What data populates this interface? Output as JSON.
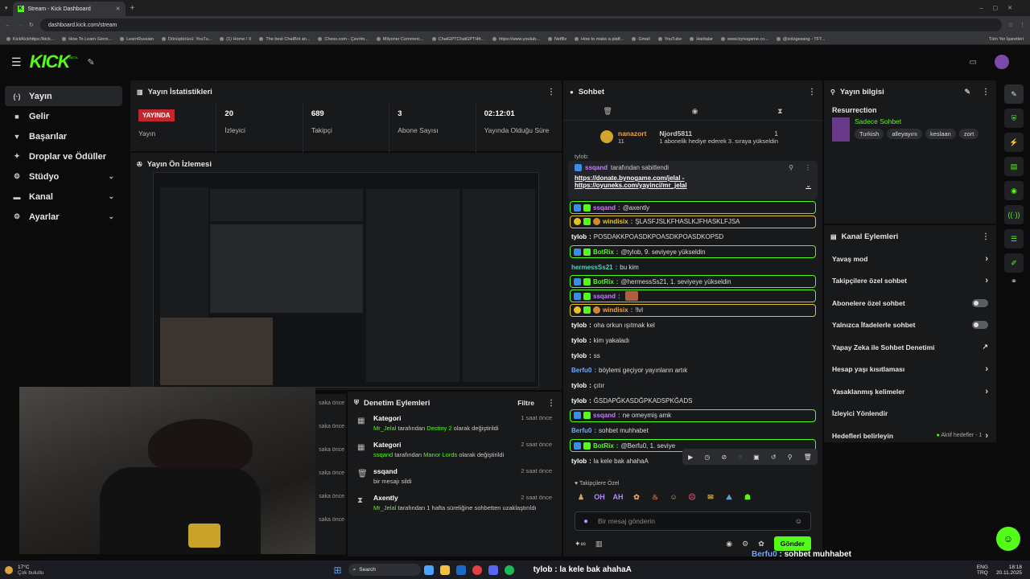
{
  "browser": {
    "tab_title": "Stream - Kick Dashboard",
    "url": "dashboard.kick.com/stream",
    "bookmarks": [
      "KickKickhttps://kick...",
      "How To Learn Germ...",
      "LearnRussian",
      "Dönüştürücü: YouTu...",
      "(1) Home / X",
      "The best ChatBot an...",
      "Chess.com - Çevrim...",
      "Milyoner Commerc...",
      "ChatGPTChatGPTHtt...",
      "https://www.youtub...",
      "Netflix",
      "How to make a platf...",
      "Gmail",
      "YouTube",
      "Haritalar",
      "www.bynogame.co...",
      "@sologesang - TFT..."
    ],
    "all_bookmarks": "Tüm Yer İşaretleri"
  },
  "app": {
    "logo": "KICK",
    "beta": "BETA"
  },
  "sidebar": {
    "items": [
      {
        "label": "Yayın",
        "icon": "(·)"
      },
      {
        "label": "Gelir",
        "icon": "■"
      },
      {
        "label": "Başarılar",
        "icon": "▼"
      },
      {
        "label": "Droplar ve Ödüller",
        "icon": "✦"
      },
      {
        "label": "Stüdyo",
        "icon": "⚙"
      },
      {
        "label": "Kanal",
        "icon": "▬"
      },
      {
        "label": "Ayarlar",
        "icon": "⚙"
      }
    ]
  },
  "stats_panel": {
    "title": "Yayın İstatistikleri",
    "live_badge": "YAYINDA",
    "live_label": "Yayın",
    "stats": [
      {
        "value": "20",
        "label": "İzleyici"
      },
      {
        "value": "689",
        "label": "Takipçi"
      },
      {
        "value": "3",
        "label": "Abone Sayısı"
      },
      {
        "value": "02:12:01",
        "label": "Yayında Olduğu Süre"
      }
    ]
  },
  "preview_panel": {
    "title": "Yayın Ön İzlemesi"
  },
  "mod_panel": {
    "title": "Denetim Eylemleri",
    "filter": "Filtre",
    "entries": [
      {
        "title": "Kategori",
        "user": "Mr_Jelal",
        "pre": " tarafından ",
        "highlight": "Destiny 2",
        "post": " olarak değiştirildi",
        "time": "1 saat önce"
      },
      {
        "title": "Kategori",
        "user": "ssqand",
        "pre": " tarafından ",
        "highlight": "Manor Lords",
        "post": " olarak değiştirildi",
        "time": "2 saat önce"
      },
      {
        "title": "ssqand",
        "user": "",
        "pre": "bir mesajı sildi",
        "highlight": "",
        "post": "",
        "time": "2 saat önce"
      },
      {
        "title": "Axently",
        "user": "Mr_Jelal",
        "pre": " tarafından 1 hafta süreliğine sohbetten uzaklaştırıldı",
        "highlight": "",
        "post": "",
        "time": "2 saat önce"
      }
    ],
    "left_times": [
      "saka önce",
      "saka önce",
      "saka önce",
      "saka önce",
      "saka önce",
      "saka önce"
    ]
  },
  "chat": {
    "title": "Sohbet",
    "top_gifter": {
      "name": "nanazort",
      "count": "11",
      "other": "Njord5811",
      "other_count": "1",
      "note": "1 abonelik hediye ederek 3. sıraya yükseldin"
    },
    "partial_line": "tylob: ",
    "pinned": {
      "by": "ssqand",
      "by_suffix": " tarafından sabitlendi",
      "link1": "https://donate.bynogame.com/jelal",
      "dash": " -",
      "link2": "https://oyuneks.com/yayinci/mr_jelal"
    },
    "messages": [
      {
        "user": "ssqand",
        "text": "@axently",
        "style": "hl",
        "ucls": "u-purple"
      },
      {
        "user": "windisix",
        "text": "ŞLASFJSLKFHASLKJFHASKLFJSA",
        "style": "hly",
        "ucls": "u-yellow"
      },
      {
        "user": "tylob",
        "text": "POSDAKKPOASDKPOASDKPOASDKOPSD",
        "style": "",
        "ucls": "u-white"
      },
      {
        "user": "BotRix",
        "text": "@tylob, 9. seviyeye yükseldin",
        "style": "hl",
        "ucls": "u-green"
      },
      {
        "user": "hermessSs21",
        "text": "bu kim",
        "style": "",
        "ucls": "u-teal"
      },
      {
        "user": "BotRix",
        "text": "@hermessSs21, 1. seviyeye yükseldin",
        "style": "hl",
        "ucls": "u-green"
      },
      {
        "user": "ssqand",
        "text": "",
        "style": "hl",
        "ucls": "u-purple"
      },
      {
        "user": "windisix",
        "text": "!lvl",
        "style": "hly",
        "ucls": "u-orange"
      },
      {
        "user": "tylob",
        "text": "oha orkun ışıtmak kel",
        "style": "",
        "ucls": "u-white"
      },
      {
        "user": "tylob",
        "text": "kim yakaladı",
        "style": "",
        "ucls": "u-white"
      },
      {
        "user": "tylob",
        "text": "ss",
        "style": "",
        "ucls": "u-white"
      },
      {
        "user": "Berfu0",
        "text": "böylemi geçiyor yayınların artık",
        "style": "",
        "ucls": "u-blue"
      },
      {
        "user": "tylob",
        "text": "çıtır",
        "style": "",
        "ucls": "u-white"
      },
      {
        "user": "tylob",
        "text": "ĞSDAPĞKASDĞPKADSPKĞADS",
        "style": "",
        "ucls": "u-white"
      },
      {
        "user": "ssqand",
        "text": "ne omeymiş amk",
        "style": "hl",
        "ucls": "u-purple"
      },
      {
        "user": "Berfu0",
        "text": "sohbet muhhabet",
        "style": "",
        "ucls": "u-blue"
      },
      {
        "user": "BotRix",
        "text": "@Berfu0, 1. seviye",
        "style": "hl",
        "ucls": "u-green"
      },
      {
        "user": "tylob",
        "text": "la kele bak ahahaA",
        "style": "",
        "ucls": "u-white"
      }
    ],
    "emote_label": "Takipçilere Özel",
    "emotes": [
      "OH",
      "AH"
    ],
    "input_placeholder": "Bir mesaj gönderin",
    "send": "Gönder"
  },
  "stream_info": {
    "title": "Yayın bilgisi",
    "stream_title": "Resurrection",
    "category": "Sadece Sohbet",
    "tags": [
      "Turkish",
      "alleyayını",
      "keslaan",
      "zort"
    ]
  },
  "channel_actions": {
    "title": "Kanal Eylemleri",
    "items": [
      {
        "label": "Yavaş mod",
        "control": "chevron"
      },
      {
        "label": "Takipçilere özel sohbet",
        "control": "chevron"
      },
      {
        "label": "Abonelere özel sohbet",
        "control": "toggle"
      },
      {
        "label": "Yalnızca İfadelerle sohbet",
        "control": "toggle"
      },
      {
        "label": "Yapay Zeka ile Sohbet Denetimi",
        "control": "external"
      },
      {
        "label": "Hesap yaşı kısıtlaması",
        "control": "chevron"
      },
      {
        "label": "Yasaklanmış kelimeler",
        "control": "chevron"
      },
      {
        "label": "İzleyici Yönlendir",
        "control": "none"
      },
      {
        "label": "Hedefleri belirleyin",
        "control": "chevron"
      }
    ],
    "goals_status": "Aktif hedefler - 1"
  },
  "overlay": {
    "line1_user": "Berfu0",
    "line1_text": " : sohbet muhhabet",
    "line2_user": "tylob",
    "line2_text": " : la kele bak ahahaA"
  },
  "taskbar": {
    "weather_temp": "17°C",
    "weather_text": "Çok bulutlu",
    "search": "Search",
    "lang": "ENG",
    "lang2": "TRQ",
    "time": "18:18",
    "date": "20.11.2025"
  },
  "colors": {
    "accent": "#53fc18",
    "live": "#c1282d",
    "panel": "#18191b"
  }
}
